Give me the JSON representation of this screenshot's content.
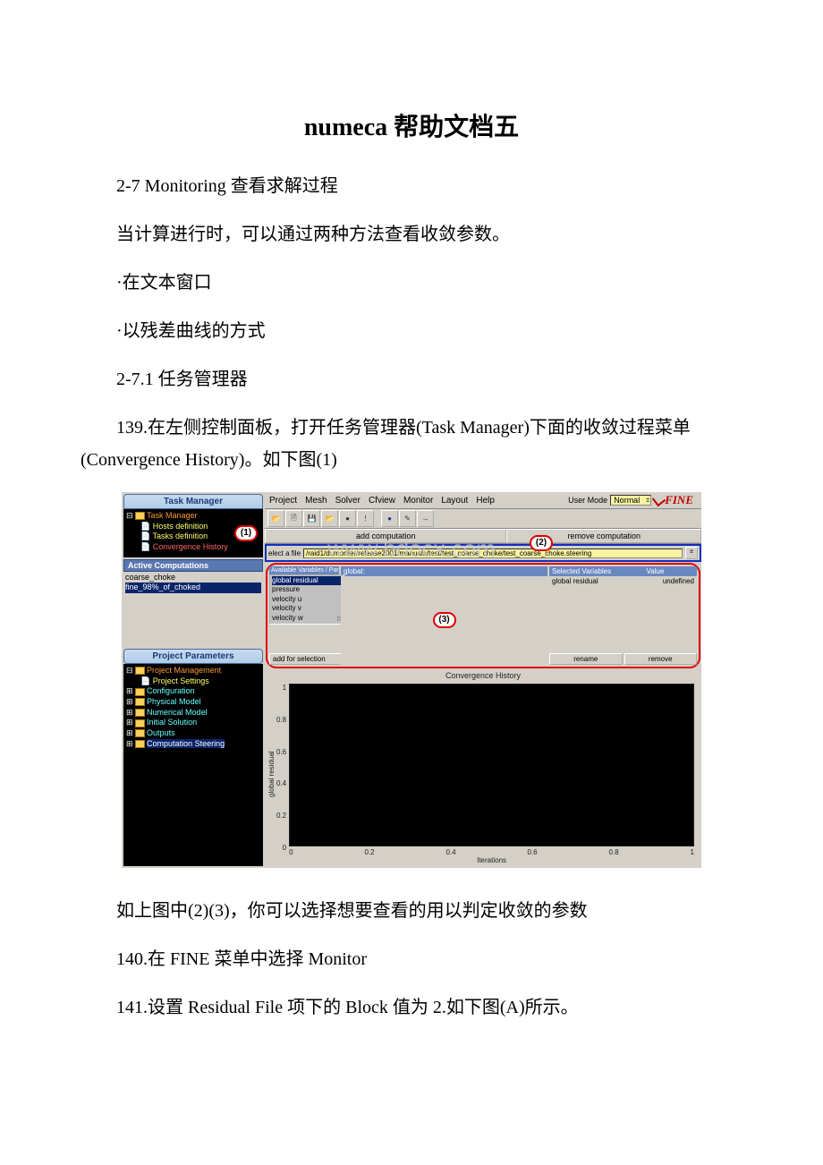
{
  "doc": {
    "title": "numeca 帮助文档五",
    "p1": "2-7 Monitoring 查看求解过程",
    "p2": "当计算进行时，可以通过两种方法查看收敛参数。",
    "p3": "·在文本窗口",
    "p4": "·以残差曲线的方式",
    "p5": "2-7.1 任务管理器",
    "p6": "139.在左侧控制面板，打开任务管理器(Task Manager)下面的收敛过程菜单(Convergence History)。如下图(1)",
    "p7": "如上图中(2)(3)，你可以选择想要查看的用以判定收敛的参数",
    "p8": "140.在 FINE 菜单中选择 Monitor",
    "p9": "141.设置 Residual File 项下的 Block 值为 2.如下图(A)所示。"
  },
  "app": {
    "left": {
      "task_title": "Task Manager",
      "tree1": {
        "root": "Task Manager",
        "hosts": "Hosts definition",
        "tasks": "Tasks definition",
        "conv": "Convergence History"
      },
      "active_comp": "Active Computations",
      "comps": {
        "a": "coarse_choke",
        "b": "fine_98%_of_choked"
      },
      "proj_title": "Project Parameters",
      "tree2": {
        "pm": "Project Management",
        "ps": "Project Settings",
        "cfg": "Configuration",
        "phy": "Physical Model",
        "num": "Numerical Model",
        "ini": "Initial Solution",
        "out": "Outputs",
        "cs": "Computation Steering"
      }
    },
    "menu": {
      "project": "Project",
      "mesh": "Mesh",
      "solver": "Solver",
      "cfview": "Cfview",
      "monitor": "Monitor",
      "layout": "Layout",
      "help": "Help",
      "usermode_label": "User Mode",
      "usermode_value": "Normal",
      "logo": "FINE"
    },
    "toolbar": {
      "open": "📂",
      "new": "🗎",
      "save": "💾",
      "open2": "📂",
      "dot": "●",
      "bang": "!",
      "blob": "●",
      "wand": "✎",
      "arrow": "→"
    },
    "row": {
      "add": "add computation",
      "remove": "remove computation"
    },
    "file": {
      "label": "elect a file",
      "path": "/raid1/dumortier/release2001/manuals/test/test_coarse_choke/test_coarse_choke.steering"
    },
    "vars": {
      "header_left": "Available Variables / Parameters type:",
      "header_mid": "global:",
      "header_right_l": "Selected Variables",
      "header_right_r": "Value",
      "list": {
        "gr": "global residual",
        "p": "pressure",
        "u": "velocity u",
        "v": "velocity v",
        "w": "velocity w"
      },
      "addsel": "add for selection",
      "rename": "rename",
      "remove": "remove",
      "sel_name": "global residual",
      "sel_val": "undefined"
    },
    "conv_title": "Convergence History",
    "chart": {
      "ylabel": "global residual",
      "yticks": {
        "t1": "1",
        "t08": "0.8",
        "t06": "0.6",
        "t04": "0.4",
        "t02": "0.2",
        "t0": "0"
      },
      "xticks": {
        "x0": "0",
        "x02": "0.2",
        "x04": "0.4",
        "x06": "0.6",
        "x08": "0.8",
        "x1": "1"
      },
      "xlabel": "Iterations"
    },
    "pills": {
      "one": "(1)",
      "two": "(2)",
      "three": "(3)"
    },
    "watermark": "www.bdocx.com"
  },
  "chart_data": {
    "type": "line",
    "title": "Convergence History",
    "xlabel": "Iterations",
    "ylabel": "global residual",
    "xlim": [
      0,
      1
    ],
    "ylim": [
      0,
      1
    ],
    "series": [
      {
        "name": "global residual",
        "x": [],
        "y": []
      }
    ],
    "note": "Plot area is empty (no data drawn) in the screenshot."
  }
}
